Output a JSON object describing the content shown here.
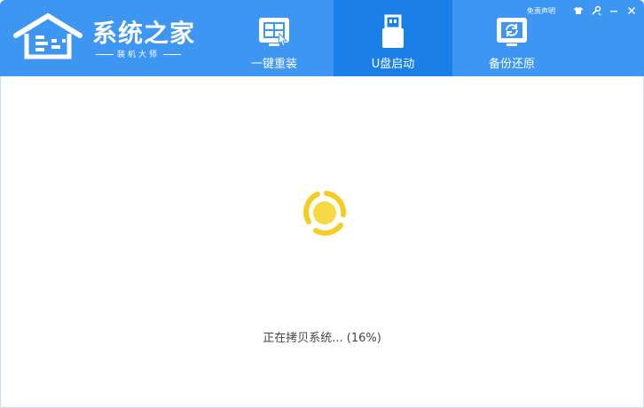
{
  "header": {
    "logo_title": "系统之家",
    "logo_subtitle": "装机大师",
    "disclaimer": "免责声明",
    "tabs": [
      {
        "label": "一键重装",
        "icon": "windows-install-icon",
        "active": false
      },
      {
        "label": "U盘启动",
        "icon": "usb-drive-icon",
        "active": true
      },
      {
        "label": "备份还原",
        "icon": "backup-restore-icon",
        "active": false
      }
    ],
    "window_controls": [
      "skin-icon",
      "settings-icon",
      "minimize-icon",
      "close-icon"
    ]
  },
  "main": {
    "status_text": "正在拷贝系统...",
    "progress_text": "(16%)",
    "progress": 0.16
  },
  "colors": {
    "header_bg": "#3d97f2",
    "active_tab_bg": "#1a7fe6",
    "spinner": "#f5cd22",
    "spinner_center": "#f6d844",
    "status_text": "#444444"
  }
}
